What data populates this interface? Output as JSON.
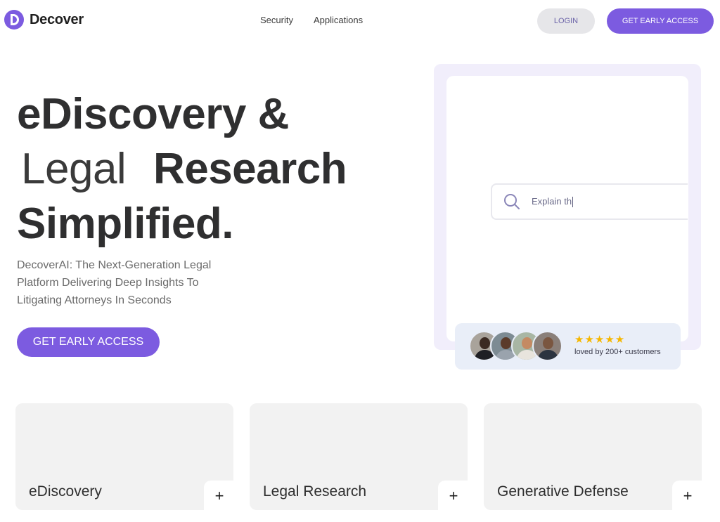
{
  "brand": {
    "name": "Decover",
    "color": "#7c5be0"
  },
  "nav": {
    "items": [
      "Security",
      "Applications"
    ]
  },
  "header": {
    "login_label": "LOGIN",
    "cta_label": "GET EARLY ACCESS"
  },
  "hero": {
    "title_line1": "eDiscovery &",
    "title_highlight": "Legal",
    "title_line2_rest": "Research",
    "title_line3": "Simplified.",
    "subtitle": "DecoverAI: The Next-Generation Legal Platform Delivering Deep Insights To Litigating Attorneys In Seconds",
    "cta_label": "GET EARLY ACCESS"
  },
  "mockup": {
    "search_value": "Explain th",
    "search_icon": "search-icon",
    "rating_stars": "★★★★★",
    "rating_text": "loved by 200+ customers"
  },
  "cards": [
    {
      "label": "eDiscovery",
      "action": "+"
    },
    {
      "label": "Legal Research",
      "action": "+"
    },
    {
      "label": "Generative Defense",
      "action": "+"
    }
  ]
}
